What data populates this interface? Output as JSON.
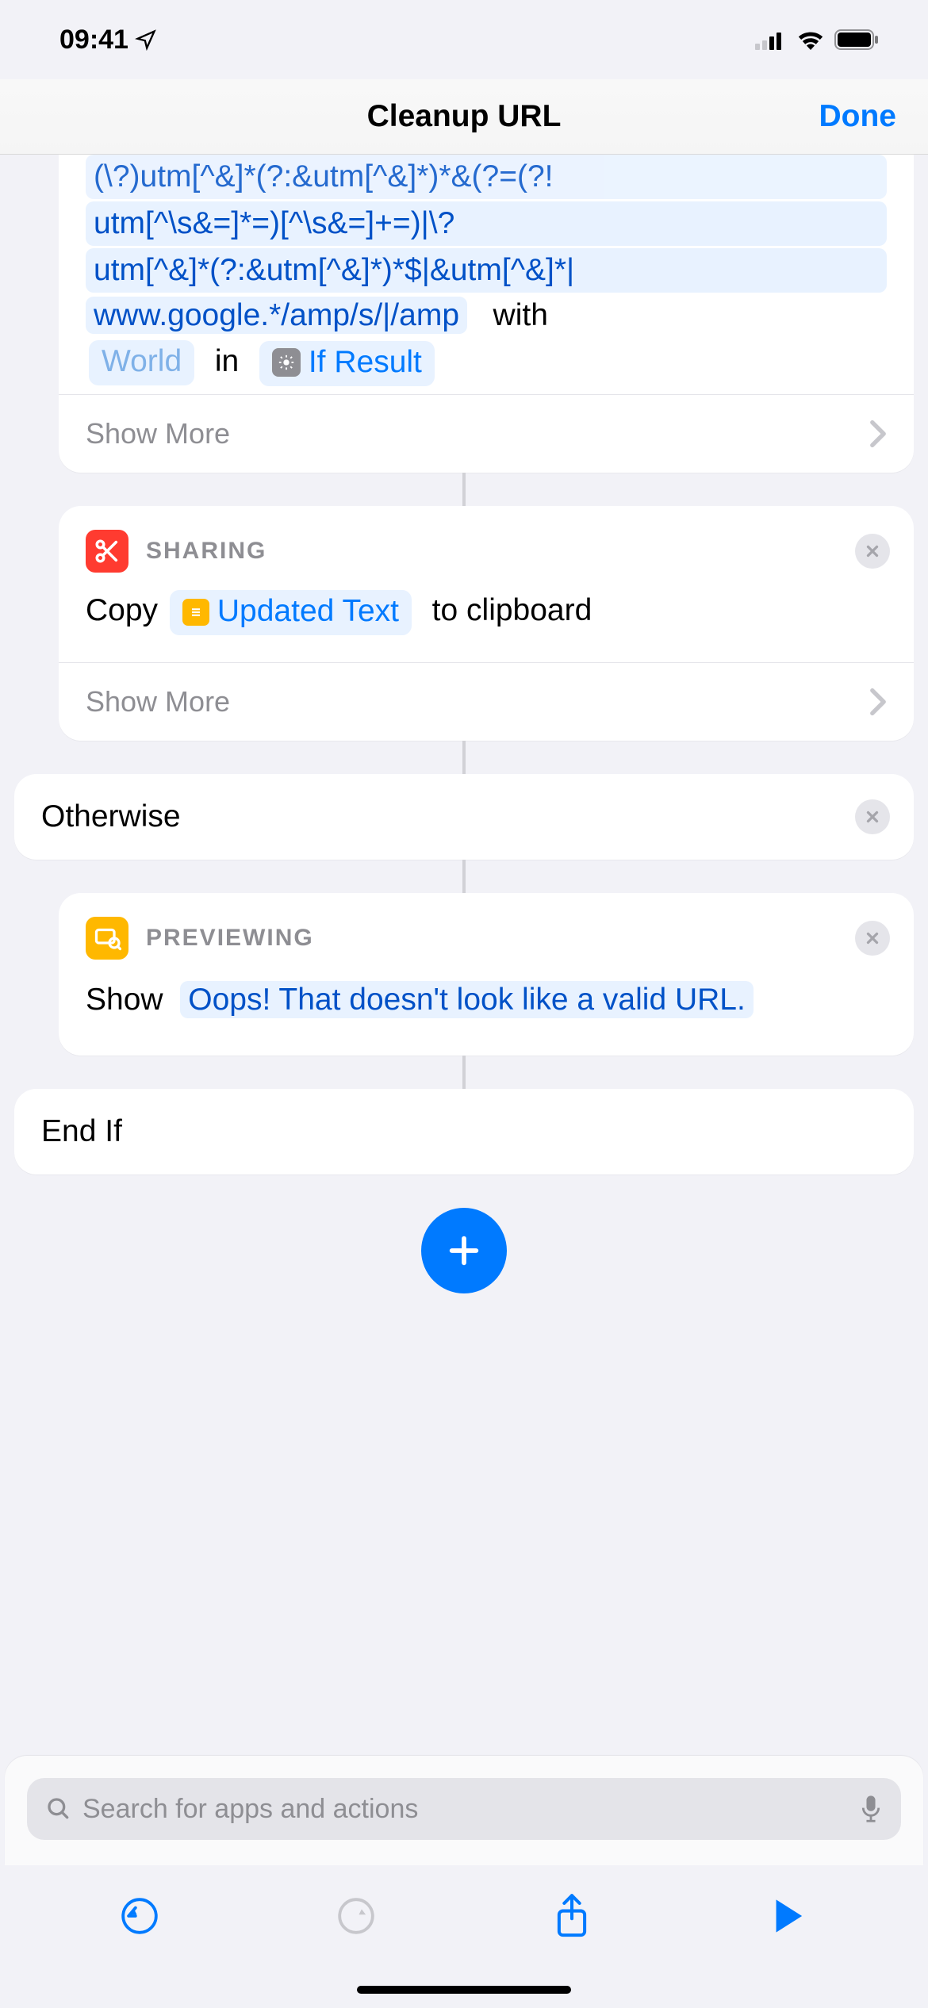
{
  "status": {
    "time": "09:41"
  },
  "nav": {
    "title": "Cleanup URL",
    "done": "Done"
  },
  "replace_action": {
    "regex_line1": "(\\?)utm[^&]*(?:&utm[^&]*)*&(?=(?!",
    "regex_line2": "utm[^\\s&=]*=)[^\\s&=]+=)|\\?",
    "regex_line3": "utm[^&]*(?:&utm[^&]*)*$|&utm[^&]*|",
    "regex_line4": "www.google.*/amp/s/|/amp",
    "with_label": "with",
    "with_value": "World",
    "in_label": "in",
    "in_value": "If Result",
    "show_more": "Show More"
  },
  "sharing_action": {
    "header": "SHARING",
    "prefix": "Copy",
    "token": "Updated Text",
    "suffix": "to clipboard",
    "show_more": "Show More"
  },
  "otherwise": {
    "label": "Otherwise"
  },
  "preview_action": {
    "header": "PREVIEWING",
    "prefix": "Show",
    "message": "Oops! That doesn't look like a valid URL."
  },
  "endif": {
    "label": "End If"
  },
  "search": {
    "placeholder": "Search for apps and actions"
  }
}
